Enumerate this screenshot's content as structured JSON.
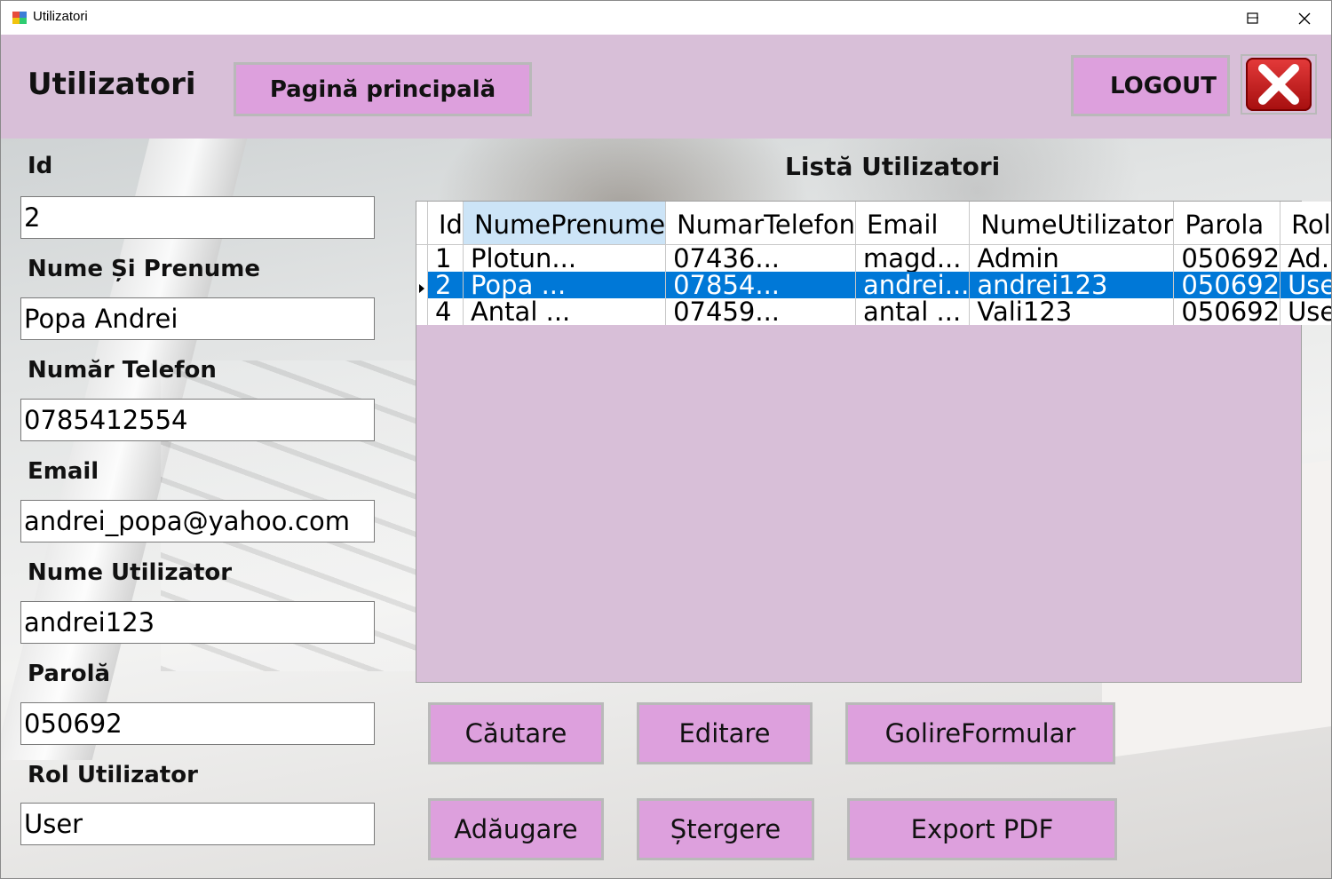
{
  "window": {
    "title": "Utilizatori"
  },
  "header": {
    "title": "Utilizatori",
    "home_button": "Pagină principală",
    "logout_button": "LOGOUT"
  },
  "form": {
    "id_label": "Id",
    "id_value": "2",
    "name_label": "Nume Și Prenume",
    "name_value": "Popa Andrei",
    "phone_label": "Număr Telefon",
    "phone_value": "0785412554",
    "email_label": "Email",
    "email_value": "andrei_popa@yahoo.com",
    "username_label": "Nume Utilizator",
    "username_value": "andrei123",
    "password_label": "Parolă",
    "password_value": "050692",
    "role_label": "Rol Utilizator",
    "role_value": "User"
  },
  "list": {
    "title": "Listă Utilizatori",
    "columns": [
      "Id",
      "NumePrenume",
      "NumarTelefon",
      "Email",
      "NumeUtilizator",
      "Parola",
      "Rol"
    ],
    "rows": [
      [
        "1",
        "Plotun...",
        "07436...",
        "magd...",
        "Admin",
        "050692",
        "Ad..."
      ],
      [
        "2",
        "Popa ...",
        "07854...",
        "andrei...",
        "andrei123",
        "050692",
        "User"
      ],
      [
        "4",
        "Antal ...",
        "07459...",
        "antal ...",
        "Vali123",
        "050692",
        "User"
      ]
    ],
    "selected_row": 1
  },
  "actions": {
    "search": "Căutare",
    "edit": "Editare",
    "clear": "GolireFormular",
    "add": "Adăugare",
    "delete": "Ștergere",
    "export": "Export PDF"
  },
  "colors": {
    "header_bg": "#d8bfd8",
    "button_bg": "#dda0dd",
    "selection": "#0078d7",
    "grid_bg": "#d8bfd8"
  },
  "icons": [
    "app-icon",
    "minimize-icon",
    "maximize-icon",
    "close-icon",
    "big-close-icon",
    "row-pointer-icon"
  ]
}
